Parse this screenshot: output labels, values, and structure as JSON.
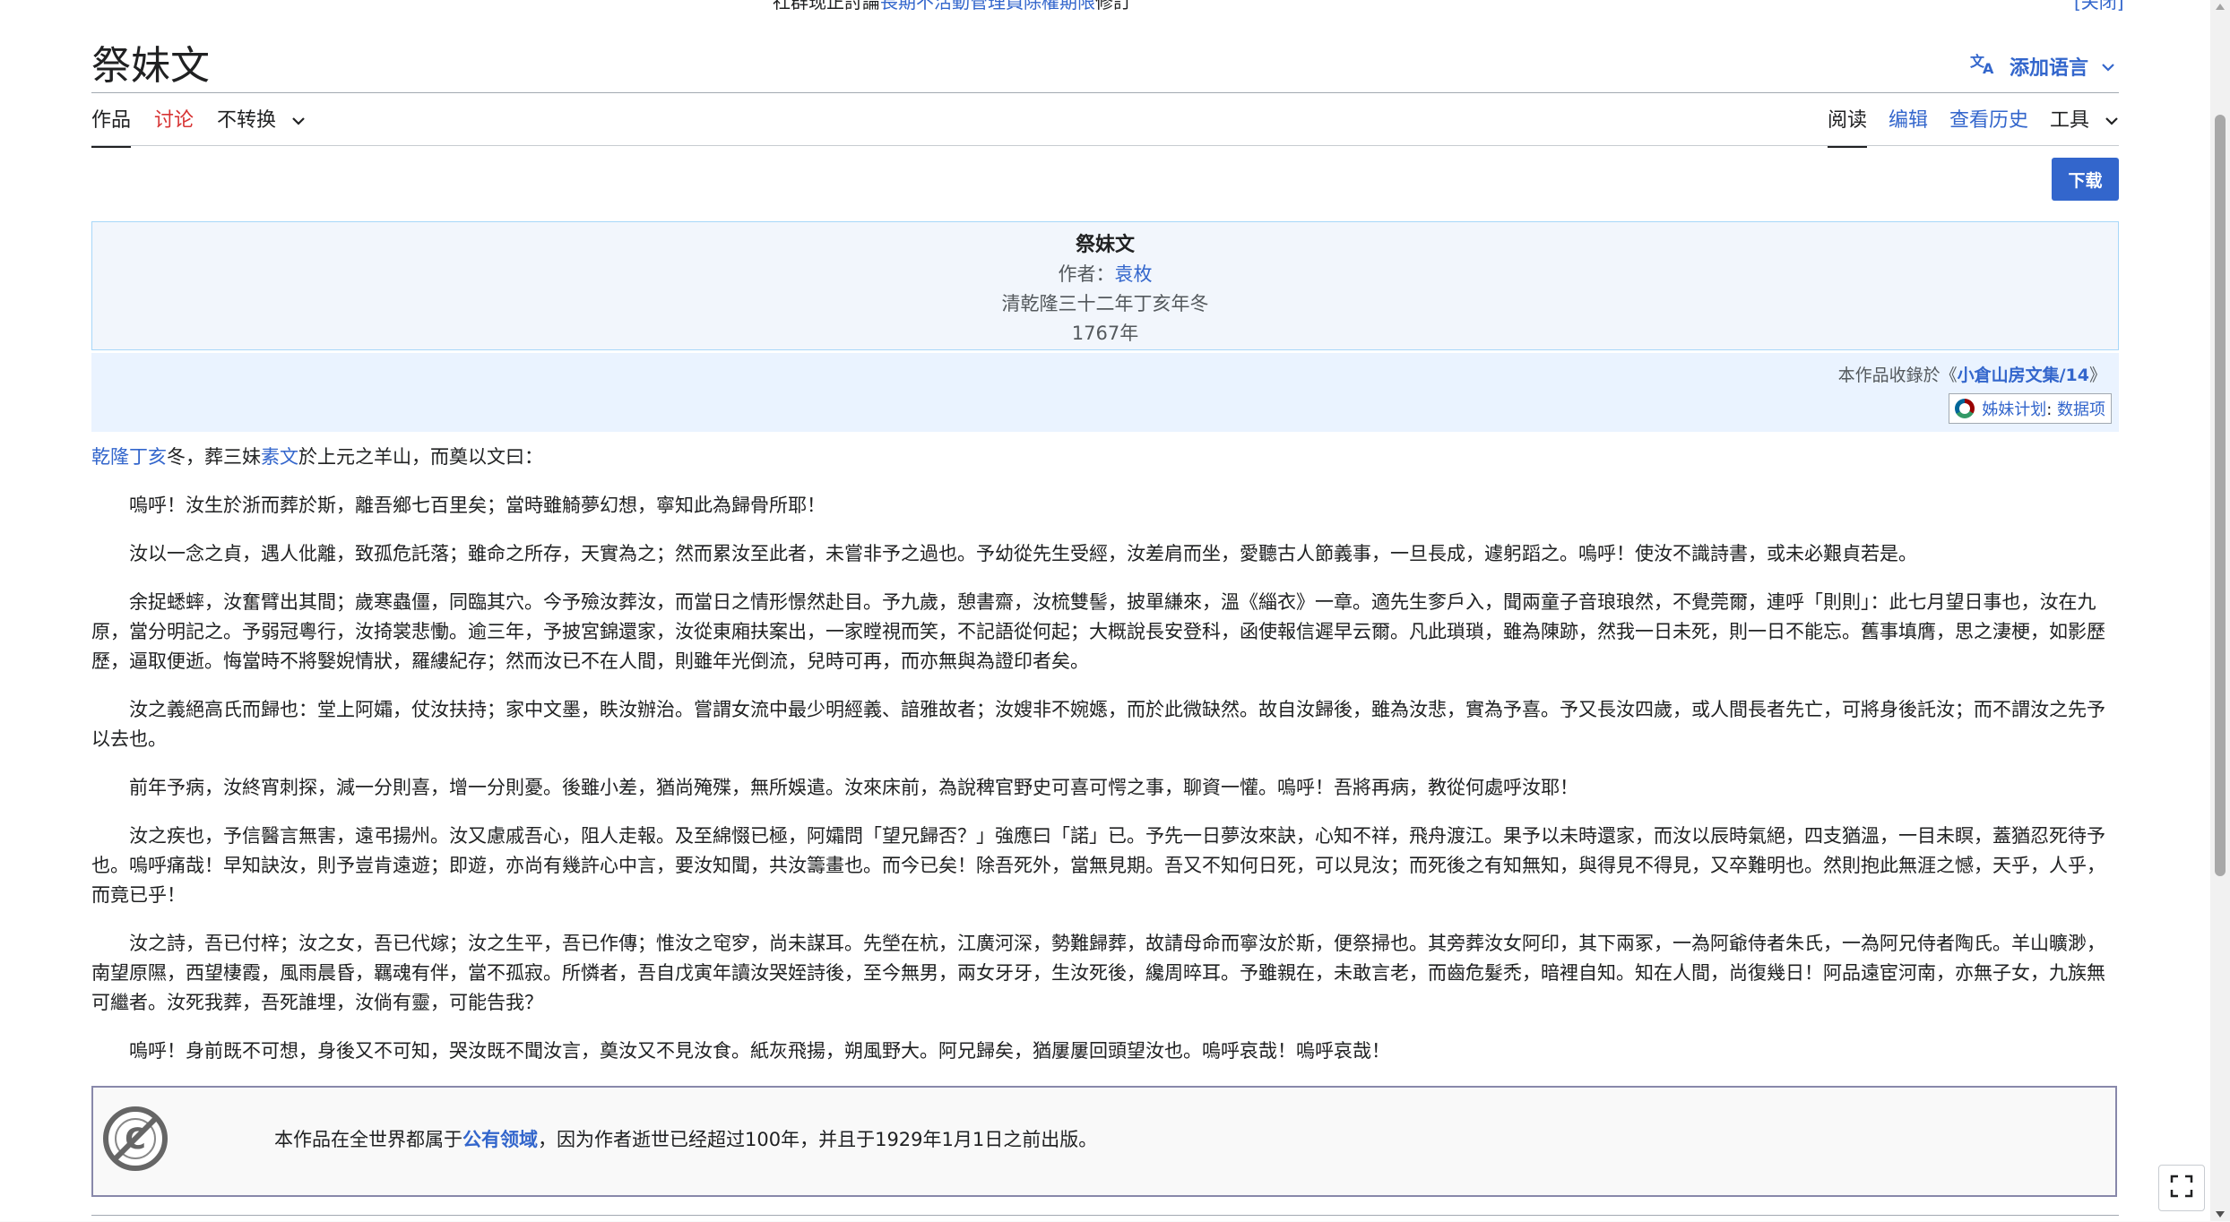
{
  "notice": {
    "prefix": "社群现正討論",
    "link": "長期不活動管理員除權期限",
    "suffix": "修訂",
    "close": "[关闭]"
  },
  "page": {
    "title": "祭妹文",
    "add_language": "添加语言"
  },
  "tabs": {
    "left": [
      "作品",
      "讨论",
      "不转换"
    ],
    "right": [
      "阅读",
      "编辑",
      "查看历史",
      "工具"
    ]
  },
  "download_label": "下载",
  "header": {
    "title": "祭妹文",
    "author_label": "作者：",
    "author": "袁枚",
    "date_text": "清乾隆三十二年丁亥年冬",
    "year": "1767年"
  },
  "collection": {
    "prefix": "本作品收錄於《",
    "name": "小倉山房文集/14",
    "suffix": "》",
    "sister_label": "姊妹计划",
    "sister_sep": ": ",
    "sister_item": "数据项"
  },
  "intro": {
    "link1": "乾隆丁亥",
    "text1": "冬，葬三妹",
    "link2": "素文",
    "text2": "於上元之羊山，而奠以文曰："
  },
  "paragraphs": [
    "嗚呼！汝生於浙而葬於斯，離吾鄉七百里矣；當時雖觭夢幻想，寧知此為歸骨所耶！",
    "汝以一念之貞，遇人仳離，致孤危託落；雖命之所存，天實為之；然而累汝至此者，未嘗非予之過也。予幼從先生受經，汝差肩而坐，愛聽古人節義事，一旦長成，遽躬蹈之。嗚呼！使汝不識詩書，或未必艱貞若是。",
    "余捉蟋蟀，汝奮臂出其間；歲寒蟲僵，同臨其穴。今予殮汝葬汝，而當日之情形憬然赴目。予九歲，憩書齋，汝梳雙髻，披單縑來，溫《緇衣》一章。適先生奓戶入，聞兩童子音琅琅然，不覺莞爾，連呼「則則」：此七月望日事也，汝在九原，當分明記之。予弱冠粵行，汝掎裳悲慟。逾三年，予披宮錦還家，汝從東廂扶案出，一家瞠視而笑，不記語從何起；大概說長安登科，函使報信遲早云爾。凡此瑣瑣，雖為陳跡，然我一日未死，則一日不能忘。舊事填膺，思之淒梗，如影歷歷，逼取便逝。悔當時不將嫛婗情狀，羅縷紀存；然而汝已不在人間，則雖年光倒流，兒時可再，而亦無與為證印者矣。",
    "汝之義絕高氏而歸也：堂上阿孀，仗汝扶持；家中文墨，眣汝辦治。嘗謂女流中最少明經義、諳雅故者；汝嫂非不婉嫕，而於此微缺然。故自汝歸後，雖為汝悲，實為予喜。予又長汝四歲，或人間長者先亡，可將身後託汝；而不謂汝之先予以去也。",
    "前年予病，汝終宵刺探，減一分則喜，增一分則憂。後雖小差，猶尚殗殜，無所娛遣。汝來床前，為說稗官野史可喜可愕之事，聊資一懽。嗚呼！吾將再病，教從何處呼汝耶！",
    "汝之疾也，予信醫言無害，遠弔揚州。汝又慮戚吾心，阻人走報。及至綿惙已極，阿孀問「望兄歸否？」強應曰「諾」已。予先一日夢汝來訣，心知不祥，飛舟渡江。果予以未時還家，而汝以辰時氣絕，四支猶溫，一目未瞑，蓋猶忍死待予也。嗚呼痛哉！早知訣汝，則予豈肯遠遊；即遊，亦尚有幾許心中言，要汝知聞，共汝籌畫也。而今已矣！除吾死外，當無見期。吾又不知何日死，可以見汝；而死後之有知無知，與得見不得見，又卒難明也。然則抱此無涯之憾，天乎，人乎，而竟已乎！",
    "汝之詩，吾已付梓；汝之女，吾已代嫁；汝之生平，吾已作傳；惟汝之窀穸，尚未謀耳。先塋在杭，江廣河深，勢難歸葬，故請母命而寧汝於斯，便祭掃也。其旁葬汝女阿印，其下兩冢，一為阿爺侍者朱氏，一為阿兄侍者陶氏。羊山曠渺，南望原隰，西望棲霞，風雨晨昏，羈魂有伴，當不孤寂。所憐者，吾自戊寅年讀汝哭姪詩後，至今無男，兩女牙牙，生汝死後，纔周晬耳。予雖親在，未敢言老，而齒危髮禿，暗裡自知。知在人間，尚復幾日！阿品遠宦河南，亦無子女，九族無可繼者。汝死我葬，吾死誰埋，汝倘有靈，可能告我？",
    "嗚呼！身前既不可想，身後又不可知，哭汝既不聞汝言，奠汝又不見汝食。紙灰飛揚，朔風野大。阿兄歸矣，猶屢屢回頭望汝也。嗚呼哀哉！嗚呼哀哉！"
  ],
  "license": {
    "prefix": "本作品在全世界都属于",
    "link": "公有领域",
    "suffix": "，因为作者逝世已经超过100年，并且于1929年1月1日之前出版。"
  },
  "colors": {
    "link": "#3366cc",
    "red_link": "#d73333",
    "header_bg": "#f2f6fc",
    "button": "#3366cc"
  }
}
